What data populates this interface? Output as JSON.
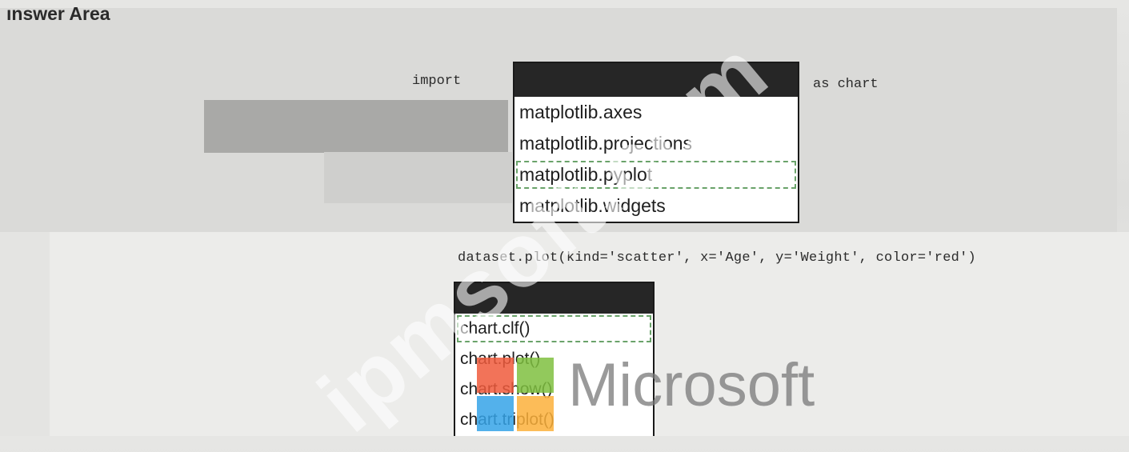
{
  "heading": "ınswer Area",
  "code": {
    "import_keyword": "import",
    "as_keyword": "as chart",
    "plot_line": "dataset.plot(kind='scatter', x='Age', y='Weight', color='red')"
  },
  "import_dropdown": {
    "options": [
      "matplotlib.axes",
      "matplotlib.projections",
      "matplotlib.pyplot",
      "matplotlib.widgets"
    ],
    "selected": "matplotlib.pyplot"
  },
  "show_dropdown": {
    "options": [
      "chart.clf()",
      "chart.plot()",
      "chart.show()",
      "chart.triplot()"
    ],
    "selected": "chart.clf()"
  },
  "watermark": {
    "text": "ipmsoft.com",
    "brand_text": "Microsoft",
    "logo_colors": [
      "#f05a3c",
      "#7fbf3f",
      "#35a3e8",
      "#fbb03b"
    ]
  }
}
